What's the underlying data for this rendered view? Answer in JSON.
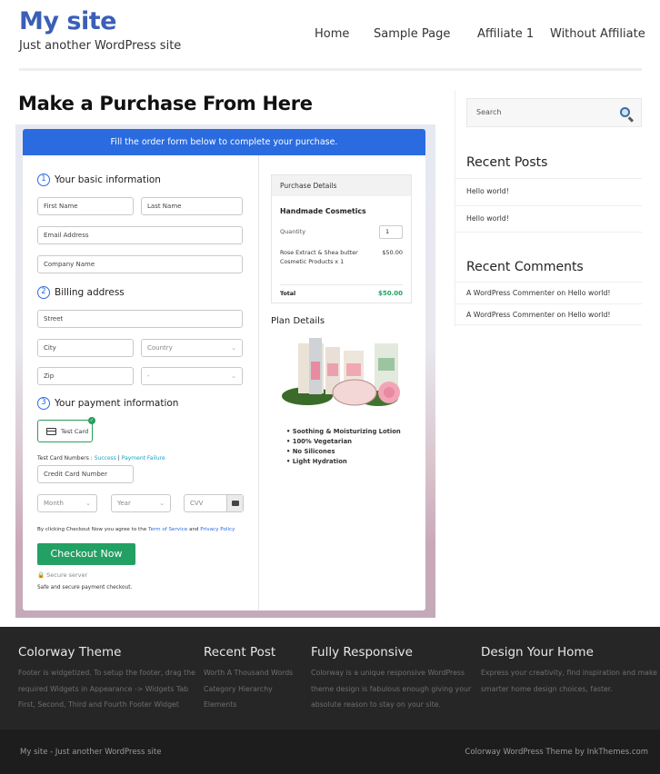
{
  "header": {
    "site_title": "My site",
    "tagline": "Just another WordPress site",
    "nav": [
      "Home",
      "Sample Page",
      "Affiliate 1",
      "Without Affiliate"
    ]
  },
  "page": {
    "title": "Make a Purchase From Here"
  },
  "form": {
    "banner": "Fill the order form below to complete your purchase.",
    "section1": {
      "num": "1",
      "title": "Your basic information"
    },
    "section2": {
      "num": "2",
      "title": "Billing address"
    },
    "section3": {
      "num": "3",
      "title": "Your payment information"
    },
    "placeholders": {
      "first_name": "First Name",
      "last_name": "Last Name",
      "email": "Email Address",
      "company": "Company Name",
      "street": "Street",
      "city": "City",
      "country": "Country",
      "zip": "Zip",
      "state": "-",
      "card_number": "Credit Card Number",
      "month": "Month",
      "year": "Year",
      "cvv": "CVV"
    },
    "payment_method": "Test Card",
    "test_card_label": "Test Card Numbers : ",
    "test_success": "Success",
    "test_sep": " | ",
    "test_failure": "Payment Failure",
    "agree_prefix": "By clicking Checkout Now you agree to the ",
    "terms": "Term of Service",
    "agree_and": " and ",
    "privacy": "Privacy Policy",
    "checkout_button": "Checkout Now",
    "secure_server": "Secure server",
    "safe_text": "Safe and secure payment checkout."
  },
  "purchase": {
    "heading": "Purchase Details",
    "product": "Handmade Cosmetics",
    "quantity_label": "Quantity",
    "quantity": "1",
    "item": "Rose Extract & Shea butter Cosmetic Products x 1",
    "item_price": "$50.00",
    "total_label": "Total",
    "total": "$50.00",
    "accent_color": "#23a064"
  },
  "plan": {
    "title": "Plan Details",
    "features": [
      "Soothing & Moisturizing Lotion",
      "100% Vegetarian",
      "No Silicones",
      "Light Hydration"
    ]
  },
  "sidebar": {
    "search_placeholder": "Search",
    "recent_posts_title": "Recent Posts",
    "recent_posts": [
      "Hello world!",
      "Hello world!"
    ],
    "recent_comments_title": "Recent Comments",
    "recent_comments": [
      "A WordPress Commenter on Hello world!",
      "A WordPress Commenter on Hello world!"
    ]
  },
  "footer": {
    "cols": [
      {
        "title": "Colorway Theme",
        "lines": [
          "Footer is widgetized. To setup the footer, drag the",
          "required Widgets in Appearance -> Widgets Tab",
          "First, Second, Third and Fourth Footer Widget"
        ]
      },
      {
        "title": "Recent Post",
        "lines": [
          "Worth A Thousand Words",
          "Category Hierarchy",
          "Elements"
        ]
      },
      {
        "title": "Fully Responsive",
        "lines": [
          "Colorway is a unique responsive WordPress",
          "theme design is fabulous enough giving your",
          "absolute reason to stay on your site."
        ]
      },
      {
        "title": "Design Your Home",
        "lines": [
          "Express your creativity, find inspiration and make",
          "smarter home design choices, faster."
        ]
      }
    ],
    "bottom_left": "My site - Just another WordPress site",
    "bottom_right": "Colorway WordPress Theme by InkThemes.com"
  },
  "colors": {
    "brand_blue": "#2a6be0",
    "site_title": "#3b5fb7",
    "checkout_green": "#23a064"
  }
}
